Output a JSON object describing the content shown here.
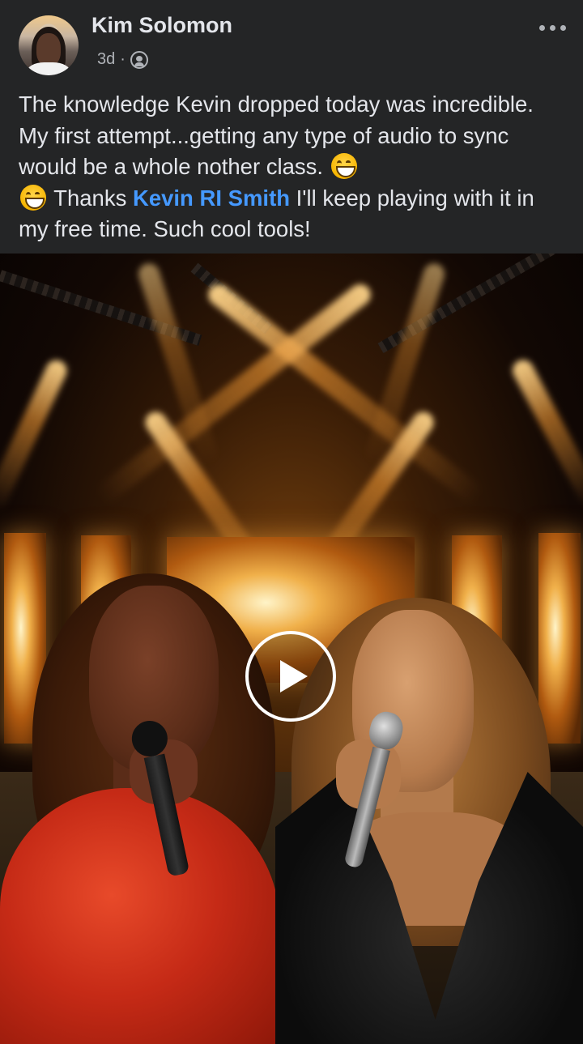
{
  "post": {
    "author_name": "Kim Solomon",
    "timestamp": "3d",
    "separator": "·",
    "audience_icon": "globe-icon",
    "more_icon": "more-dots-icon",
    "text": {
      "part1": "The knowledge Kevin dropped today was incredible. My first attempt...getting any type of audio to sync would be a whole nother class. ",
      "emoji1": "😄",
      "emoji2": "😄",
      "part2": " Thanks ",
      "mention": "Kevin RI Smith",
      "part3": "  I'll keep playing with it in my free time. Such cool tools!"
    }
  },
  "video": {
    "play_icon": "play-icon"
  },
  "colors": {
    "background": "#242526",
    "text": "#e4e6eb",
    "secondary_text": "#b0b3b8",
    "mention": "#4599ff"
  }
}
